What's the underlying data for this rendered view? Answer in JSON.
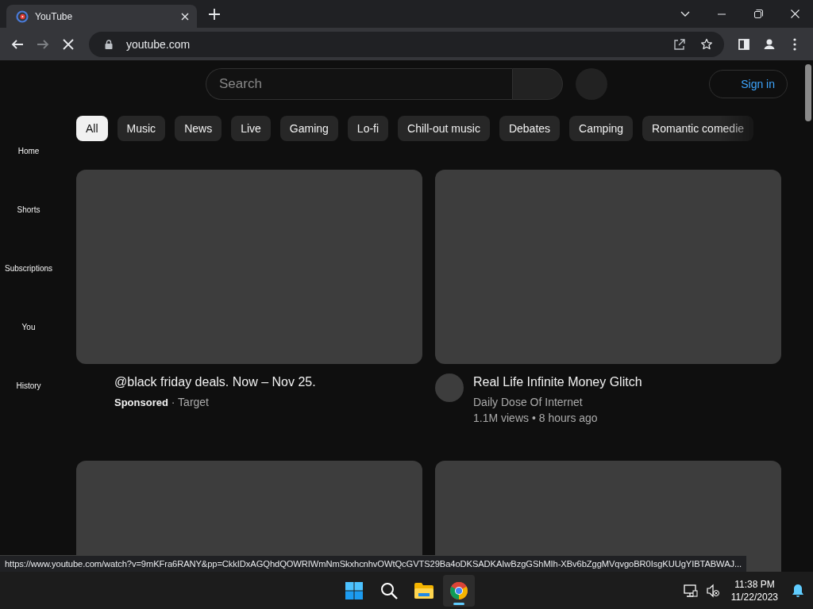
{
  "browser": {
    "tab": {
      "title": "YouTube",
      "selected": true
    },
    "back": {
      "disabled": false
    },
    "forward": {
      "disabled": true
    },
    "loading": true,
    "address": "youtube.com"
  },
  "page": {
    "search": {
      "placeholder": "Search"
    },
    "sign_in": "Sign in",
    "sidebar": {
      "items": [
        {
          "label": "Home"
        },
        {
          "label": "Shorts"
        },
        {
          "label": "Subscriptions"
        },
        {
          "label": "You"
        },
        {
          "label": "History"
        }
      ]
    },
    "chips": [
      {
        "label": "All",
        "selected": true
      },
      {
        "label": "Music",
        "selected": false
      },
      {
        "label": "News",
        "selected": false
      },
      {
        "label": "Live",
        "selected": false
      },
      {
        "label": "Gaming",
        "selected": false
      },
      {
        "label": "Lo-fi",
        "selected": false
      },
      {
        "label": "Chill-out music",
        "selected": false
      },
      {
        "label": "Debates",
        "selected": false
      },
      {
        "label": "Camping",
        "selected": false
      },
      {
        "label": "Romantic comedie",
        "selected": false
      }
    ],
    "videos": [
      {
        "kind": "ad",
        "title": "@black friday deals. Now – Nov 25.",
        "byline": "**Sponsored** · Target"
      },
      {
        "kind": "video",
        "title": "Real Life Infinite Money Glitch",
        "channel": "Daily Dose Of Internet",
        "meta": "1.1M views • 8 hours ago"
      },
      {
        "kind": "loading"
      },
      {
        "kind": "loading"
      }
    ],
    "status_url": "https://www.youtube.com/watch?v=9mKFra6RANY&pp=CkkIDxAGQhdQOWRIWmNmSkxhcnhvOWtQcGVTS29Ba4oDKSADKAIwBzgGShMIh-XBv6bZggMVqvgoBR0IsgKUUgYIBTABWAJ..."
  },
  "taskbar": {
    "apps": [
      {
        "kind": "start",
        "active": false
      },
      {
        "kind": "search",
        "active": false
      },
      {
        "kind": "explorer",
        "active": false
      },
      {
        "kind": "chrome",
        "active": true
      }
    ],
    "time": "11:38 PM",
    "date": "11/22/2023"
  }
}
